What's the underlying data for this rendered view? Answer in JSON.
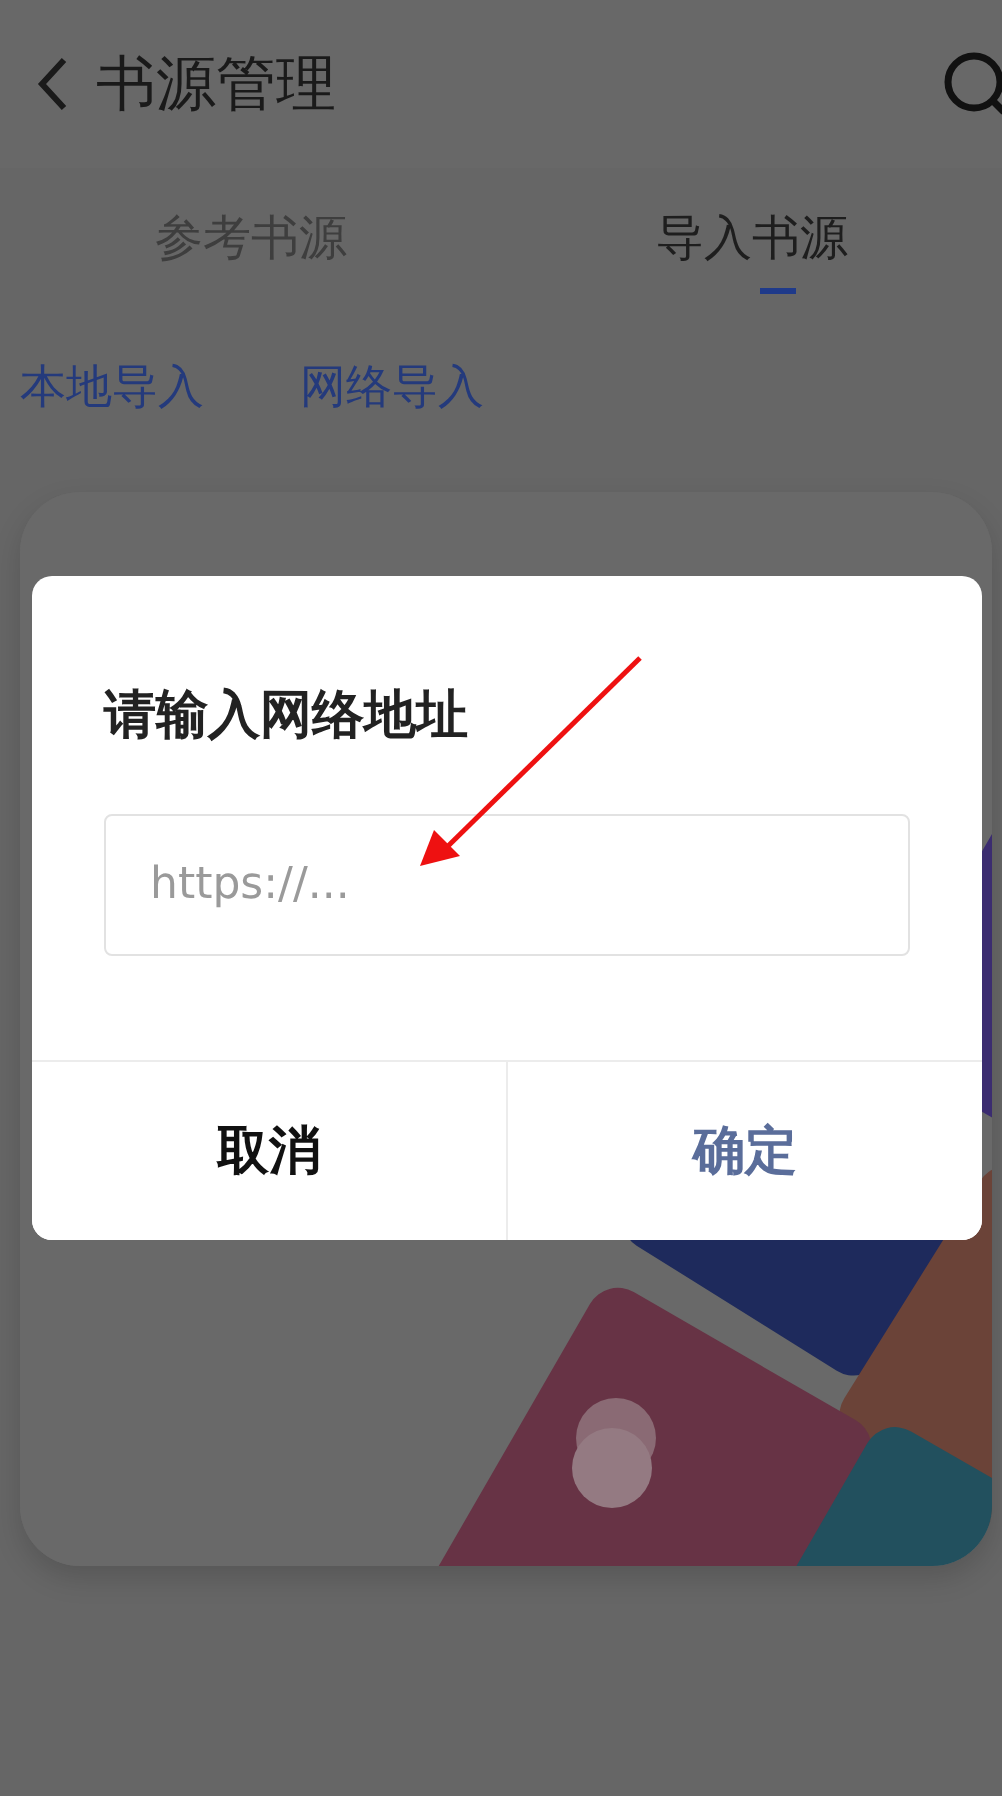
{
  "header": {
    "title": "书源管理"
  },
  "tabs": [
    {
      "label": "参考书源",
      "selected": false
    },
    {
      "label": "导入书源",
      "selected": true
    }
  ],
  "import_options": [
    "本地导入",
    "网络导入"
  ],
  "dialog": {
    "title": "请输入网络地址",
    "input": {
      "placeholder": "https://..."
    },
    "buttons": [
      {
        "label": "取消",
        "kind": "cancel"
      },
      {
        "label": "确定",
        "kind": "confirm"
      }
    ]
  }
}
